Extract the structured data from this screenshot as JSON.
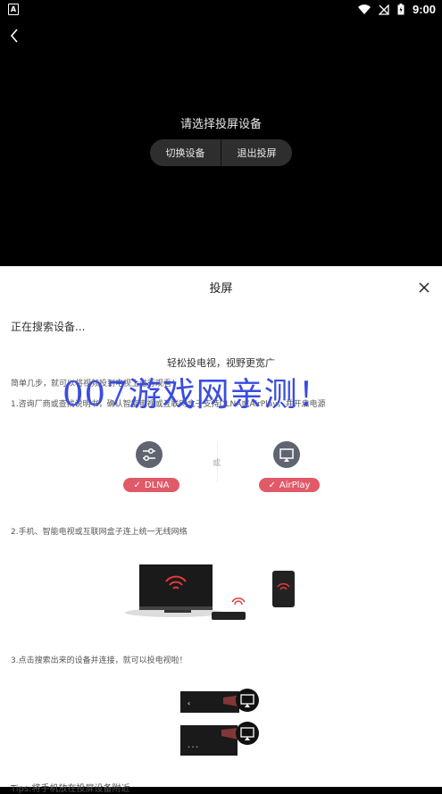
{
  "status_bar": {
    "left_icon_letter": "A",
    "time": "9:00"
  },
  "player": {
    "title": "请选择投屏设备",
    "switch_label": "切换设备",
    "exit_label": "退出投屏"
  },
  "sheet": {
    "title": "投屏",
    "searching": "正在搜索设备...",
    "hero": "轻松投电视，视野更宽广",
    "intro": "简单几步，就可以将视频投到电视上进行观看！",
    "step1": "1.咨询厂商或查找说明书，确认智能电视或互联网盒子支持DLNA或AirPlay，并开启电源",
    "dlna_label": "DLNA",
    "or_label": "或",
    "airplay_label": "AirPlay",
    "step2": "2.手机、智能电视或互联网盒子连上统一无线网络",
    "step3": "3.点击搜索出来的设备并连接，就可以投电视啦！",
    "tips": "Tips:将手机放在投屏设备附近",
    "watermark": "007游戏网亲测！"
  },
  "colors": {
    "accent": "#e05a68",
    "watermark": "#3a4de0",
    "sheet_bg": "#ffffff",
    "player_bg": "#000000"
  }
}
